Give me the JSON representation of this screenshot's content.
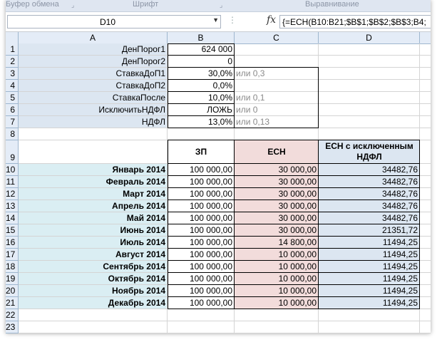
{
  "ribbon": {
    "groups": [
      "Буфер обмена",
      "Шрифт",
      "Выравнивание"
    ]
  },
  "formula_bar": {
    "name_box": "D10",
    "fx_label": "fx",
    "formula": "{=ЕСН(B10:B21;$B$1;$B$2;$B$3;B4;"
  },
  "columns": [
    "A",
    "B",
    "C",
    "D"
  ],
  "rows": [
    "1",
    "2",
    "3",
    "4",
    "5",
    "6",
    "7",
    "8",
    "9",
    "10",
    "11",
    "12",
    "13",
    "14",
    "15",
    "16",
    "17",
    "18",
    "19",
    "20",
    "21",
    "22",
    "23"
  ],
  "params": [
    {
      "label": "ДенПорог1",
      "value": "624 000",
      "hint": ""
    },
    {
      "label": "ДенПорог2",
      "value": "0",
      "hint": ""
    },
    {
      "label": "СтавкаДоП1",
      "value": "30,0%",
      "hint": "или 0,3"
    },
    {
      "label": "СтавкаДоП2",
      "value": "0,0%",
      "hint": ""
    },
    {
      "label": "СтавкаПосле",
      "value": "10,0%",
      "hint": "или 0,1"
    },
    {
      "label": "ИсключитьНДФЛ",
      "value": "ЛОЖЬ",
      "hint": "или 0"
    },
    {
      "label": "НДФЛ",
      "value": "13,0%",
      "hint": "или 0,13"
    }
  ],
  "table": {
    "headers": [
      "ЗП",
      "ЕСН",
      "ЕСН с исключенным НДФЛ"
    ],
    "rows": [
      {
        "month": "Январь 2014",
        "zp": "100 000,00",
        "esn": "30 000,00",
        "esn_ndfl": "34482,76"
      },
      {
        "month": "Февраль 2014",
        "zp": "100 000,00",
        "esn": "30 000,00",
        "esn_ndfl": "34482,76"
      },
      {
        "month": "Март 2014",
        "zp": "100 000,00",
        "esn": "30 000,00",
        "esn_ndfl": "34482,76"
      },
      {
        "month": "Апрель 2014",
        "zp": "100 000,00",
        "esn": "30 000,00",
        "esn_ndfl": "34482,76"
      },
      {
        "month": "Май 2014",
        "zp": "100 000,00",
        "esn": "30 000,00",
        "esn_ndfl": "34482,76"
      },
      {
        "month": "Июнь 2014",
        "zp": "100 000,00",
        "esn": "30 000,00",
        "esn_ndfl": "21351,72"
      },
      {
        "month": "Июль 2014",
        "zp": "100 000,00",
        "esn": "14 800,00",
        "esn_ndfl": "11494,25"
      },
      {
        "month": "Август 2014",
        "zp": "100 000,00",
        "esn": "10 000,00",
        "esn_ndfl": "11494,25"
      },
      {
        "month": "Сентябрь 2014",
        "zp": "100 000,00",
        "esn": "10 000,00",
        "esn_ndfl": "11494,25"
      },
      {
        "month": "Октябрь 2014",
        "zp": "100 000,00",
        "esn": "10 000,00",
        "esn_ndfl": "11494,25"
      },
      {
        "month": "Ноябрь 2014",
        "zp": "100 000,00",
        "esn": "10 000,00",
        "esn_ndfl": "11494,25"
      },
      {
        "month": "Декабрь 2014",
        "zp": "100 000,00",
        "esn": "10 000,00",
        "esn_ndfl": "11494,25"
      }
    ]
  },
  "colors": {
    "param_label_fill": "#dce6f1",
    "month_fill": "#daeef3",
    "esn_fill": "#f2dcdb",
    "esn_ndfl_fill": "#dce6f1"
  }
}
